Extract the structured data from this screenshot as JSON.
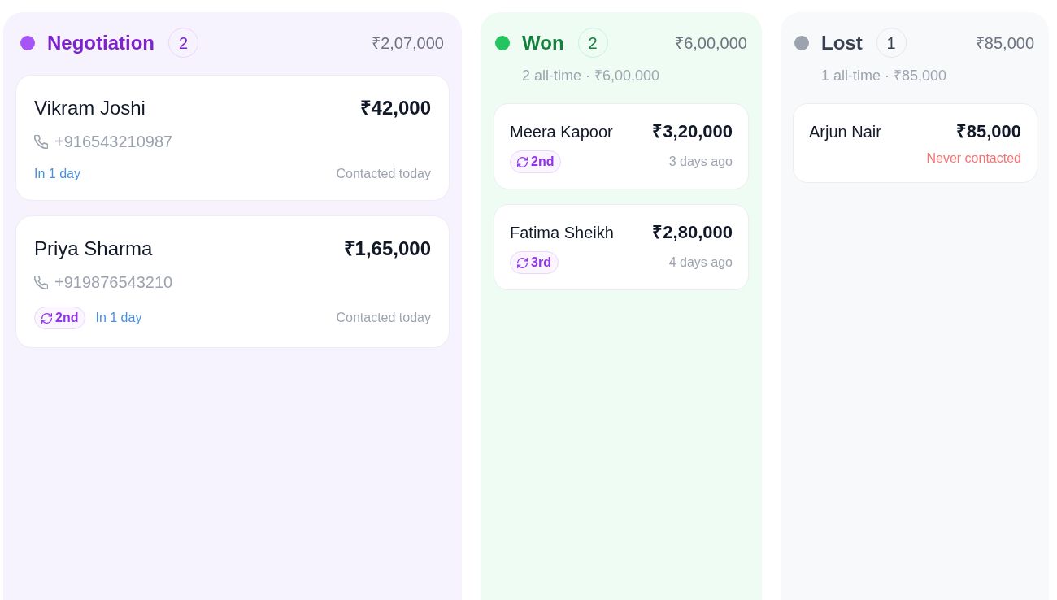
{
  "columns": [
    {
      "kind": "open",
      "title": "Negotiation",
      "color": "#a855f7",
      "count": "2",
      "total": "₹2,07,000",
      "cards": [
        {
          "kind": "detailed",
          "name": "Vikram Joshi",
          "amount": "₹42,000",
          "phone": "+916543210987",
          "next_followup": "In 1 day",
          "last_contact": {
            "kind": "recent",
            "text": "Contacted today"
          }
        },
        {
          "kind": "detailed",
          "name": "Priya Sharma",
          "amount": "₹1,65,000",
          "phone": "+919876543210",
          "round": "2nd",
          "next_followup": "In 1 day",
          "last_contact": {
            "kind": "recent",
            "text": "Contacted today"
          }
        }
      ]
    },
    {
      "kind": "won",
      "title": "Won",
      "color": "#22c55e",
      "count": "2",
      "total": "₹6,00,000",
      "summary": "2 all-time · ₹6,00,000",
      "cards": [
        {
          "kind": "compact",
          "name": "Meera Kapoor",
          "amount": "₹3,20,000",
          "round": "2nd",
          "last_contact": {
            "kind": "recent",
            "text": "3 days ago"
          }
        },
        {
          "kind": "compact",
          "name": "Fatima Sheikh",
          "amount": "₹2,80,000",
          "round": "3rd",
          "last_contact": {
            "kind": "recent",
            "text": "4 days ago"
          }
        }
      ]
    },
    {
      "kind": "lost",
      "title": "Lost",
      "color": "#9ca3af",
      "count": "1",
      "total": "₹85,000",
      "summary": "1 all-time · ₹85,000",
      "cards": [
        {
          "kind": "compact",
          "name": "Arjun Nair",
          "amount": "₹85,000",
          "last_contact": {
            "kind": "never",
            "text": "Never contacted"
          }
        }
      ]
    }
  ]
}
